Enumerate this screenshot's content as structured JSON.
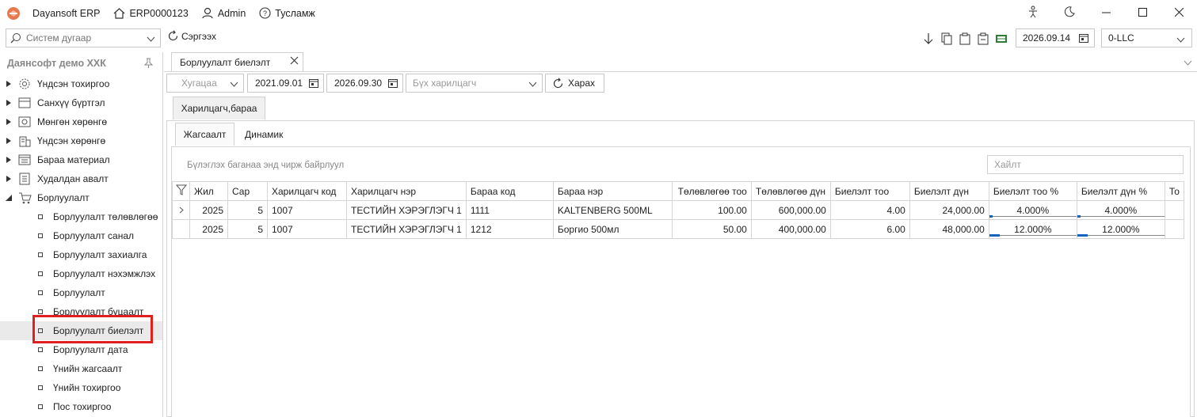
{
  "app": {
    "title": "Dayansoft ERP",
    "erp_code": "ERP0000123",
    "user": "Admin",
    "help": "Тусламж"
  },
  "toolbar": {
    "search_placeholder": "Систем дугаар",
    "refresh_label": "Сэргээх",
    "date": "2026.09.14",
    "company": "0-LLC"
  },
  "sidebar": {
    "header": "Даянсофт демо ХХК",
    "groups": [
      {
        "label": "Үндсэн тохиргоо",
        "icon": "gear-icon"
      },
      {
        "label": "Санхүү бүртгэл",
        "icon": "ledger-icon"
      },
      {
        "label": "Мөнгөн хөрөнгө",
        "icon": "cash-icon"
      },
      {
        "label": "Үндсэн хөрөнгө",
        "icon": "building-icon"
      },
      {
        "label": "Бараа материал",
        "icon": "inventory-icon"
      },
      {
        "label": "Худалдан авалт",
        "icon": "purchase-icon"
      },
      {
        "label": "Борлуулалт",
        "icon": "cart-icon"
      }
    ],
    "sales_items": [
      "Борлуулалт төлөвлөгөө",
      "Борлуулалт санал",
      "Борлуулалт захиалга",
      "Борлуулалт нэхэмжлэх",
      "Борлуулалт",
      "Борлуулалт буцаалт",
      "Борлуулалт биелэлт",
      "Борлуулалт дата",
      "Үнийн жагсаалт",
      "Үнийн тохиргоо",
      "Пос тохиргоо"
    ]
  },
  "main": {
    "doc_tab": "Борлуулалт биелэлт",
    "filters": {
      "period_placeholder": "Хугацаа",
      "date_from": "2021.09.01",
      "date_to": "2026.09.30",
      "partner_placeholder": "Бүх харилцагч",
      "view_label": "Харах"
    },
    "sub_tab": "Харилцагч,бараа",
    "inner_tabs": [
      "Жагсаалт",
      "Динамик"
    ],
    "group_hint": "Бүлэглэх баганаа энд чирж байрлуул",
    "grid_search_placeholder": "Хайлт",
    "columns": [
      "Жил",
      "Сар",
      "Харилцагч код",
      "Харилцагч нэр",
      "Бараа код",
      "Бараа нэр",
      "Төлөвлөгөө тоо",
      "Төлөвлөгөө дүн",
      "Биелэлт тоо",
      "Биелэлт дүн",
      "Биелэлт тоо %",
      "Биелэлт дүн %",
      "То"
    ],
    "rows": [
      {
        "year": "2025",
        "month": "5",
        "partner_code": "1007",
        "partner_name": "ТЕСТИЙН ХЭРЭГЛЭГЧ 1",
        "item_code": "1111",
        "item_name": "KALTENBERG 500ML",
        "plan_qty": "100.00",
        "plan_amt": "600,000.00",
        "act_qty": "4.00",
        "act_amt": "24,000.00",
        "qty_pct": "4.000%",
        "qty_pct_value": 0.04,
        "amt_pct": "4.000%",
        "amt_pct_value": 0.04
      },
      {
        "year": "2025",
        "month": "5",
        "partner_code": "1007",
        "partner_name": "ТЕСТИЙН ХЭРЭГЛЭГЧ 1",
        "item_code": "1212",
        "item_name": "Боргио 500мл",
        "plan_qty": "50.00",
        "plan_amt": "400,000.00",
        "act_qty": "6.00",
        "act_amt": "48,000.00",
        "qty_pct": "12.000%",
        "qty_pct_value": 0.12,
        "amt_pct": "12.000%",
        "amt_pct_value": 0.12
      }
    ]
  },
  "colors": {
    "highlight": "#e0201f",
    "progress": "#1565c0"
  }
}
